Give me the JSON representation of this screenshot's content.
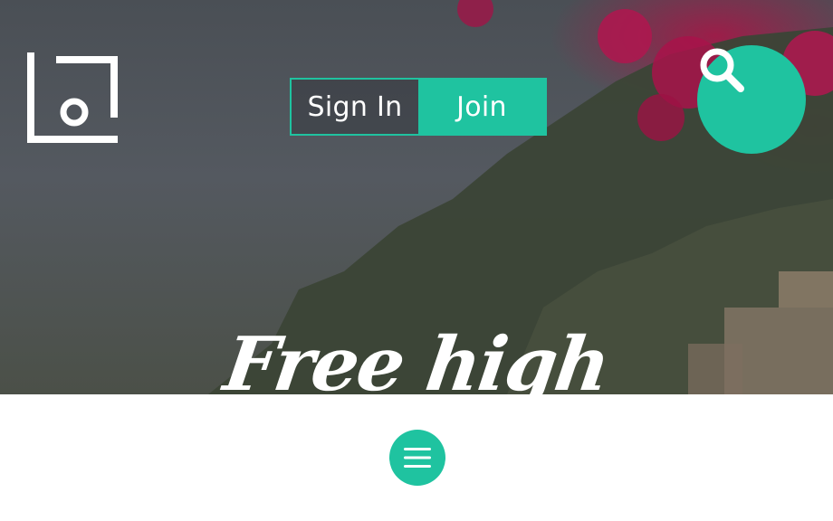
{
  "header": {
    "logo_icon": "logo-mark-icon",
    "auth": {
      "signin_label": "Sign In",
      "join_label": "Join"
    },
    "search_icon": "search-icon"
  },
  "hero": {
    "headline": "Free high"
  },
  "nav": {
    "menu_icon": "hamburger-menu-icon"
  },
  "colors": {
    "accent": "#1fc3a0",
    "text_light": "#ffffff",
    "page_bg": "#ffffff"
  }
}
